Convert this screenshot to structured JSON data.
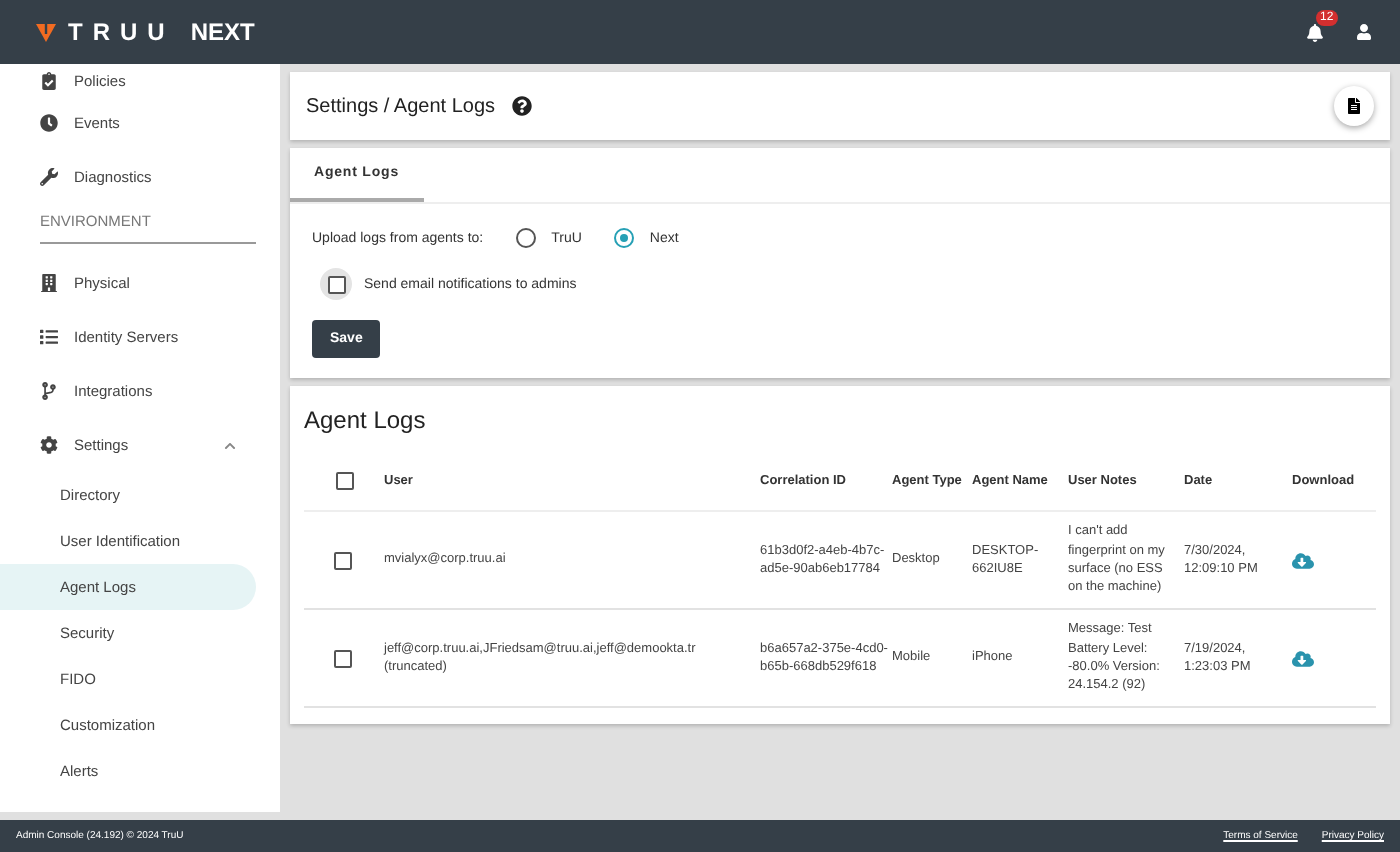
{
  "header": {
    "brand": "TRUU",
    "product": "NEXT",
    "notification_count": "12"
  },
  "sidebar": {
    "items": [
      {
        "kind": "link",
        "label": "Policies",
        "selected": false
      },
      {
        "kind": "link",
        "label": "Events",
        "selected": false
      },
      {
        "kind": "link",
        "label": "Diagnostics",
        "selected": false
      },
      {
        "kind": "section",
        "label": "ENVIRONMENT"
      },
      {
        "kind": "link",
        "label": "Physical",
        "selected": false
      },
      {
        "kind": "link",
        "label": "Identity Servers",
        "selected": false
      },
      {
        "kind": "link",
        "label": "Integrations",
        "selected": false
      },
      {
        "kind": "group",
        "label": "Settings",
        "expanded": true,
        "children": [
          {
            "label": "Directory",
            "selected": false
          },
          {
            "label": "User Identification",
            "selected": false
          },
          {
            "label": "Agent Logs",
            "selected": true
          },
          {
            "label": "Security",
            "selected": false
          },
          {
            "label": "FIDO",
            "selected": false
          },
          {
            "label": "Customization",
            "selected": false
          },
          {
            "label": "Alerts",
            "selected": false
          }
        ]
      }
    ]
  },
  "page_title": "Settings / Agent Logs",
  "tabs": [
    {
      "label": "Agent Logs",
      "selected": true
    }
  ],
  "upload": {
    "label": "Upload logs from agents to:",
    "options": [
      {
        "label": "TruU",
        "selected": false
      },
      {
        "label": "Next",
        "selected": true
      }
    ]
  },
  "email_notifications": {
    "label": "Send email notifications to admins",
    "checked": false
  },
  "save_button": "Save",
  "logs": {
    "title": "Agent Logs",
    "columns": [
      "User",
      "Correlation ID",
      "Agent Type",
      "Agent Name",
      "User Notes",
      "Date",
      "Download"
    ],
    "all_checked": false,
    "rows": [
      {
        "checked": false,
        "user": "mvialyx@corp.truu.ai",
        "correlation_id": "61b3d0f2-a4eb-4b7c-ad5e-90ab6eb17784",
        "agent_type": "Desktop",
        "agent_name": "DESKTOP-662IU8E",
        "notes": "I can't add fingerprint on my surface (no ESS on the machine)",
        "date": "7/30/2024, 12:09:10 PM"
      },
      {
        "checked": false,
        "user": "jeff@corp.truu.ai,JFriedsam@truu.ai,jeff@demookta.tr (truncated)",
        "correlation_id": "b6a657a2-375e-4cd0-b65b-668db529f618",
        "agent_type": "Mobile",
        "agent_name": "iPhone",
        "notes": "Message: Test Battery Level: -80.0% Version: 24.154.2 (92)",
        "date": "7/19/2024, 1:23:03 PM"
      }
    ]
  },
  "footer": {
    "text": "Admin Console (24.192) © 2024 TruU",
    "links": [
      "Terms of Service",
      "Privacy Policy"
    ]
  }
}
